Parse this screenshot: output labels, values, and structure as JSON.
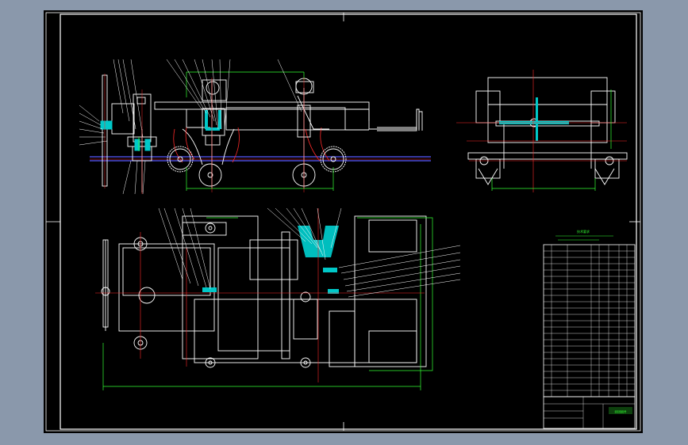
{
  "title_block": {
    "tech_req_title": "技术要求",
    "stamp_text": "装配图图号"
  },
  "colors": {
    "background": "#8a98ab",
    "sheet": "#000000",
    "linework": "#ffffff",
    "centerline": "#ff2a2a",
    "dimension": "#33ff33",
    "section_fill": "#00c8c8",
    "rail": "#5a5aff"
  }
}
